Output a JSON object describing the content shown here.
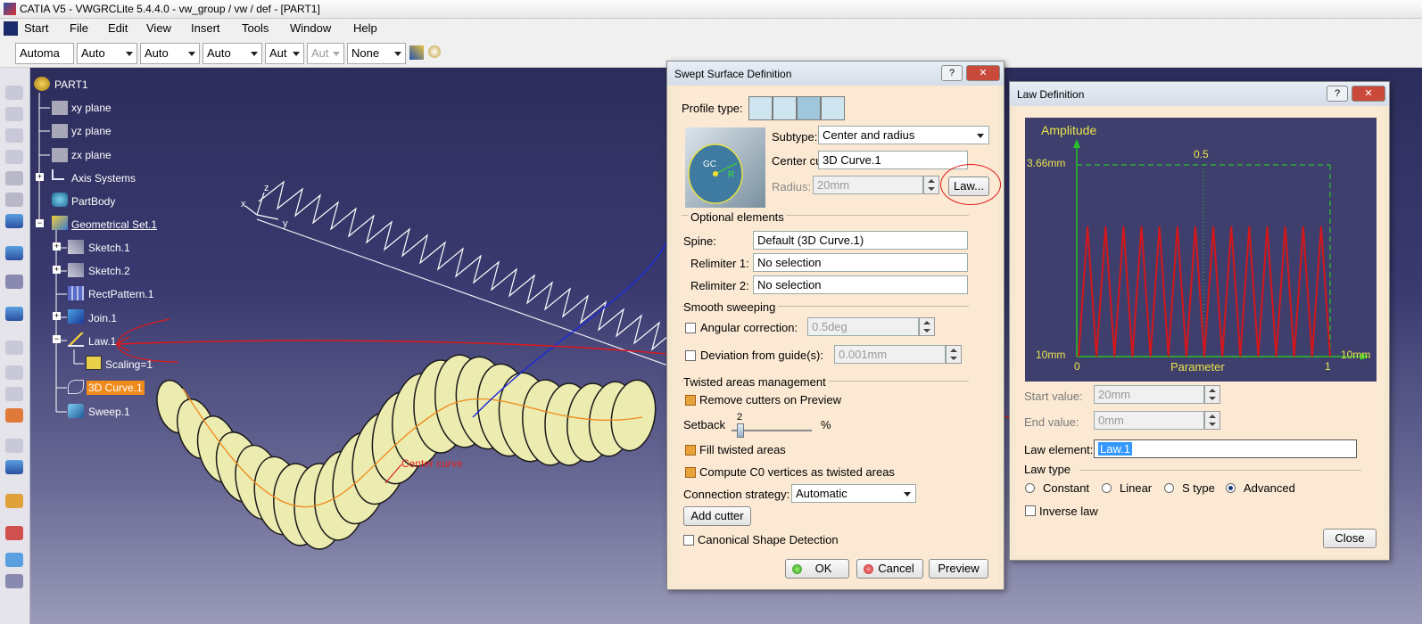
{
  "window": {
    "title": "CATIA V5 - VWGRCLite 5.4.4.0 - vw_group / vw / def - [PART1]"
  },
  "menu": [
    "Start",
    "File",
    "Edit",
    "View",
    "Insert",
    "Tools",
    "Window",
    "Help"
  ],
  "toolbar": {
    "combos": [
      "Automa",
      "Auto",
      "Auto",
      "Auto",
      "Aut",
      "Aut",
      "None"
    ]
  },
  "tree": {
    "root": "PART1",
    "items": [
      "xy plane",
      "yz plane",
      "zx plane",
      "Axis Systems",
      "PartBody",
      "Geometrical Set.1",
      "Sketch.1",
      "Sketch.2",
      "RectPattern.1",
      "Join.1",
      "Law.1",
      "Scaling=1",
      "3D Curve.1",
      "Sweep.1"
    ]
  },
  "viewport": {
    "annotation": "Center curve",
    "axes": {
      "x": "x",
      "y": "y",
      "z": "z"
    }
  },
  "swept": {
    "title": "Swept Surface Definition",
    "profile_type_label": "Profile type:",
    "subtype_label": "Subtype:",
    "subtype_value": "Center and radius",
    "center_curve_label": "Center curve:",
    "center_curve_value": "3D Curve.1",
    "radius_label": "Radius:",
    "radius_value": "20mm",
    "law_button": "Law...",
    "preview_labels": {
      "gc": "GC",
      "r": "R"
    },
    "optional_title": "Optional elements",
    "spine_label": "Spine:",
    "spine_value": "Default (3D Curve.1)",
    "relim1_label": "Relimiter 1:",
    "relim1_value": "No selection",
    "relim2_label": "Relimiter 2:",
    "relim2_value": "No selection",
    "smooth_title": "Smooth sweeping",
    "angular_label": "Angular correction:",
    "angular_value": "0.5deg",
    "deviation_label": "Deviation from guide(s):",
    "deviation_value": "0.001mm",
    "twisted_title": "Twisted areas management",
    "remove_cutters": "Remove cutters on Preview",
    "setback_label": "Setback",
    "setback_value": "2",
    "setback_unit": "%",
    "fill_twisted": "Fill twisted areas",
    "compute_c0": "Compute C0 vertices as twisted areas",
    "connection_label": "Connection strategy:",
    "connection_value": "Automatic",
    "add_cutter": "Add cutter",
    "canonical": "Canonical Shape Detection",
    "ok": "OK",
    "cancel": "Cancel",
    "preview": "Preview"
  },
  "law": {
    "title": "Law Definition",
    "amplitude": "Amplitude",
    "top_value": "3.66mm",
    "mid_value": "0.5",
    "bottom_value": "10mm",
    "x0": "0",
    "x_param": "Parameter",
    "x1": "1",
    "x_right": "10mm",
    "start_label": "Start value:",
    "start_value": "20mm",
    "end_label": "End value:",
    "end_value": "0mm",
    "element_label": "Law element:",
    "element_value": "Law.1",
    "type_title": "Law type",
    "types": [
      "Constant",
      "Linear",
      "S type",
      "Advanced"
    ],
    "inverse": "Inverse law",
    "close": "Close"
  },
  "colors": {
    "accent_orange": "#f08a1a",
    "graph_bg": "#3f3f6e",
    "graph_red": "#d4171a",
    "graph_green": "#27c227",
    "graph_yellow": "#e9e34a",
    "highlight": "#3399ff"
  }
}
